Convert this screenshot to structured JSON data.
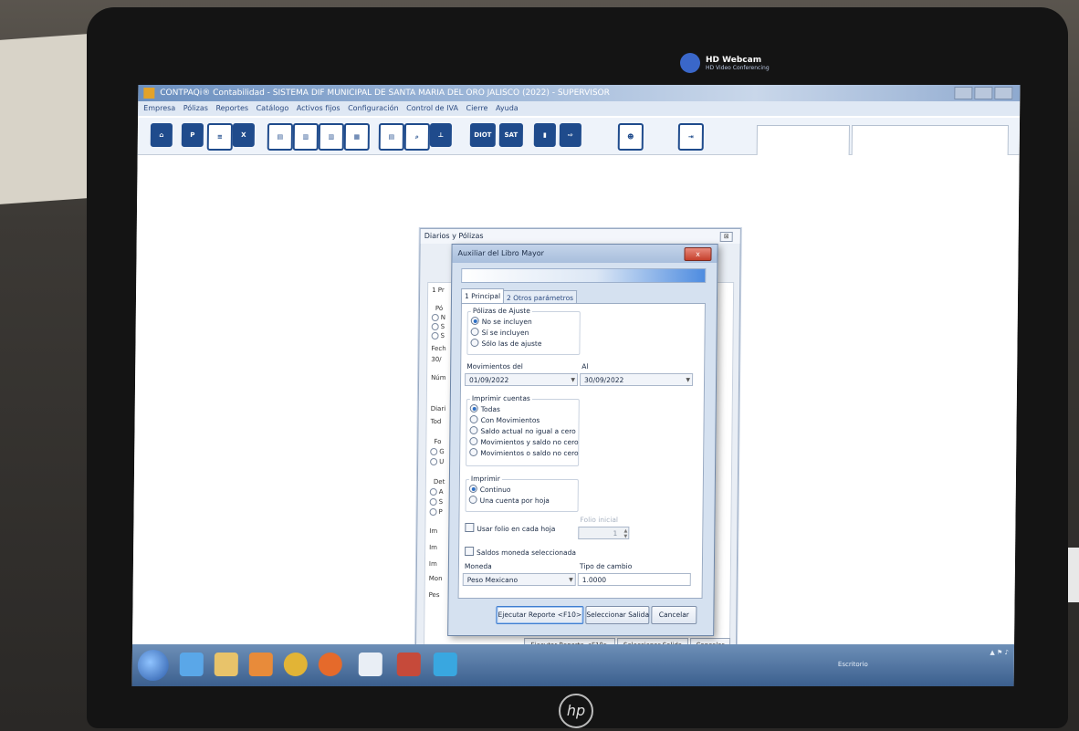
{
  "webcam": {
    "title": "HD Webcam",
    "subtitle": "HD Video Conferencing"
  },
  "window": {
    "title": "CONTPAQi® Contabilidad - SISTEMA DIF MUNICIPAL DE SANTA MARIA DEL ORO JALISCO (2022) - SUPERVISOR"
  },
  "menu": [
    "Empresa",
    "Pólizas",
    "Reportes",
    "Catálogo",
    "Activos fijos",
    "Configuración",
    "Control de IVA",
    "Cierre",
    "Ayuda"
  ],
  "toolbar": {
    "icons": [
      "home-icon",
      "poliza-search-icon",
      "list-icon",
      "xml-poliza-icon",
      "book-icon",
      "report-icon",
      "report2-icon",
      "grid-icon",
      "document-icon",
      "search-doc-icon",
      "balance-icon",
      "diot-icon",
      "sat-icon",
      "chart-icon",
      "export-icon",
      "user-icon",
      "exit-icon"
    ],
    "diot": "DIOT",
    "sat": "SAT"
  },
  "bg_dialog": {
    "title": "Diarios y Pólizas",
    "close": "⊠",
    "frags": [
      "1 Pr",
      "Pó",
      "N",
      "S",
      "S",
      "Fech",
      "30/",
      "Núm",
      "Diari",
      "Tod",
      "Fo",
      "G",
      "U",
      "Det",
      "A",
      "S",
      "P",
      "Im",
      "Im",
      "Im",
      "Mon",
      "Pes",
      "jera"
    ],
    "buttons": [
      "Ejecutar Reporte <F10>",
      "Seleccionar Salida",
      "Cancelar"
    ]
  },
  "dialog": {
    "title": "Auxiliar del Libro Mayor",
    "close": "x",
    "progress": 1.0,
    "tabs": [
      "1 Principal",
      "2 Otros parámetros"
    ],
    "polizas_ajuste": {
      "label": "Pólizas de Ajuste",
      "options": [
        "No se incluyen",
        "Sí se incluyen",
        "Sólo las de ajuste"
      ],
      "selected": 0
    },
    "movimientos_del": {
      "label": "Movimientos del",
      "value": "01/09/2022"
    },
    "al": {
      "label": "Al",
      "value": "30/09/2022"
    },
    "imprimir_cuentas": {
      "label": "Imprimir cuentas",
      "options": [
        "Todas",
        "Con Movimientos",
        "Saldo actual no igual a cero",
        "Movimientos y saldo no cero",
        "Movimientos o saldo no cero"
      ],
      "selected": 0
    },
    "imprimir": {
      "label": "Imprimir",
      "options": [
        "Continuo",
        "Una cuenta por hoja"
      ],
      "selected": 0
    },
    "usar_folio": "Usar folio en cada hoja",
    "folio_inicial": {
      "label": "Folio inicial",
      "value": "1"
    },
    "saldos_moneda": "Saldos moneda seleccionada",
    "moneda": {
      "label": "Moneda",
      "value": "Peso Mexicano"
    },
    "tipo_cambio": {
      "label": "Tipo de cambio",
      "value": "1.0000"
    },
    "buttons": {
      "execute": "Ejecutar Reporte <F10>",
      "output": "Seleccionar Salida",
      "cancel": "Cancelar"
    }
  },
  "taskbar": {
    "label": "Escritorio",
    "apps": [
      "start-orb",
      "ie-icon",
      "explorer-icon",
      "media-icon",
      "chrome-icon",
      "firefox-icon",
      "word-icon",
      "contpaq-icon",
      "info-icon"
    ]
  }
}
